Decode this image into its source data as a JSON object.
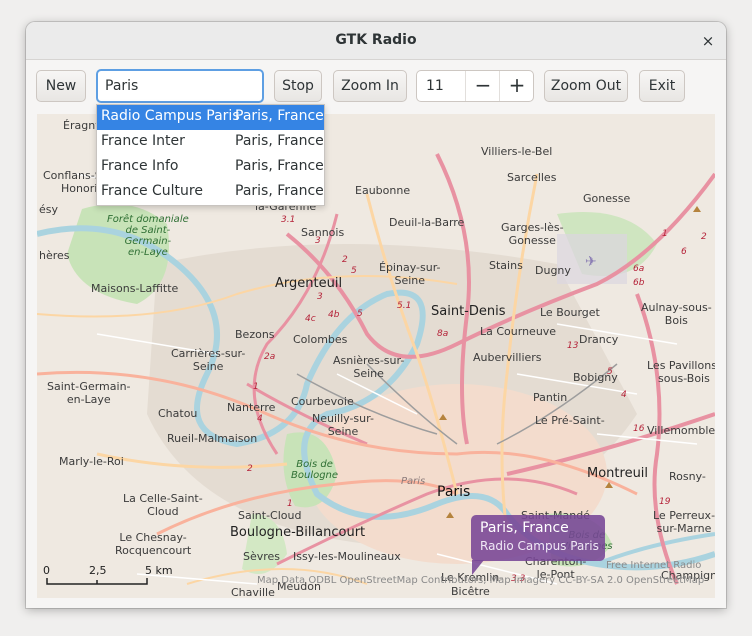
{
  "window": {
    "title": "GTK Radio"
  },
  "toolbar": {
    "new_label": "New",
    "search_value": "Paris",
    "stop_label": "Stop",
    "zoom_in_label": "Zoom In",
    "zoom_level": "11",
    "zoom_out_label": "Zoom Out",
    "exit_label": "Exit",
    "minus_glyph": "−",
    "plus_glyph": "+",
    "close_glyph": "×"
  },
  "dropdown": {
    "items": [
      {
        "name": "Radio Campus Paris",
        "location": "Paris, France",
        "selected": true
      },
      {
        "name": "France Inter",
        "location": "Paris, France",
        "selected": false
      },
      {
        "name": "France Info",
        "location": "Paris, France",
        "selected": false
      },
      {
        "name": "France Culture",
        "location": "Paris, France",
        "selected": false
      }
    ]
  },
  "popup": {
    "title": "Paris, France",
    "station": "Radio Campus Paris"
  },
  "map": {
    "labels": {
      "eragny": "Éragny",
      "conflans": "Conflans-S",
      "honorine": "Honorine",
      "resy": "ésy",
      "heres": "hères",
      "foret": "Forêt domaniale\nde Saint-\nGermain-\nen-Laye",
      "maisons": "Maisons-Laffitte",
      "garenne": "la-Garenne",
      "sannois": "Sannois",
      "eaubonne": "Eaubonne",
      "deuil": "Deuil-la-Barre",
      "villiers": "Villiers-le-Bel",
      "sarcelles": "Sarcelles",
      "gonesse": "Gonesse",
      "garges": "Garges-lès-\nGonesse",
      "epinay": "Épinay-sur-\nSeine",
      "stains": "Stains",
      "dugny": "Dugny",
      "argenteuil": "Argenteuil",
      "saint_denis": "Saint-Denis",
      "le_bourget": "Le Bourget",
      "aulnay": "Aulnay-sous-\nBois",
      "courneuve": "La Courneuve",
      "bezons": "Bezons",
      "colombes": "Colombes",
      "aubervilliers": "Aubervilliers",
      "drancy": "Drancy",
      "carrieres": "Carrières-sur-\nSeine",
      "asnieres": "Asnières-sur-\nSeine",
      "bobigny": "Bobigny",
      "pavillons": "Les Pavillons-\nsous-Bois",
      "sg_laye": "Saint-Germain-\nen-Laye",
      "chatou": "Chatou",
      "nanterre": "Nanterre",
      "courbevoie": "Courbevoie",
      "neuilly": "Neuilly-sur-\nSeine",
      "pantin": "Pantin",
      "pre": "Le Pré-Saint-",
      "villemomble": "Villemomble",
      "rueil": "Rueil-Malmaison",
      "marly": "Marly-le-Roi",
      "bois_boulogne": "Bois de\nBoulogne",
      "paris_ital": "Paris",
      "paris": "Paris",
      "montreuil": "Montreuil",
      "rosny": "Rosny-",
      "perreux": "Le Perreux-\nsur-Marne",
      "celle": "La Celle-Saint-\nCloud",
      "saint_cloud": "Saint-Cloud",
      "saint_mande": "Saint-Mandé",
      "chesnay": "Le Chesnay-\nRocquencourt",
      "boulogne": "Boulogne-Billancourt",
      "bois_vincennes": "Bois de\nVincennes",
      "sevres": "Sèvres",
      "issy": "Issy-les-Moulineaux",
      "charenton": "Charenton-\nle-Pont",
      "champigny": "Champigny",
      "kremlin": "Le Kremlin-",
      "bicetre": "Bicêtre",
      "chaville": "Chaville",
      "meudon": "Meudon"
    },
    "road_numbers": [
      "3.1",
      "3",
      "2",
      "5",
      "3",
      "4b",
      "4c",
      "5",
      "5.1",
      "8a",
      "2a",
      "1",
      "4",
      "2",
      "1",
      "13",
      "6",
      "6a",
      "6b",
      "16",
      "19",
      "3.3",
      "1",
      "2",
      "5",
      "4"
    ],
    "scale": {
      "zero": "0",
      "mid": "2,5",
      "max": "5 km"
    },
    "attribution": "Map Data ODBL OpenStreetMap Contributors, Map Imagery CC-BY-SA 2.0 OpenStreetMap",
    "brand": "Free Internet Radio"
  },
  "colors": {
    "accent": "#3584e4",
    "popup": "#7a4696",
    "water": "#aad3df",
    "park": "#c8e3b8",
    "motorway": "#e892a2",
    "trunk": "#f9b29c",
    "primary": "#fcd6a4"
  },
  "icons": [
    "close-icon",
    "minus-icon",
    "plus-icon",
    "airport-icon"
  ]
}
